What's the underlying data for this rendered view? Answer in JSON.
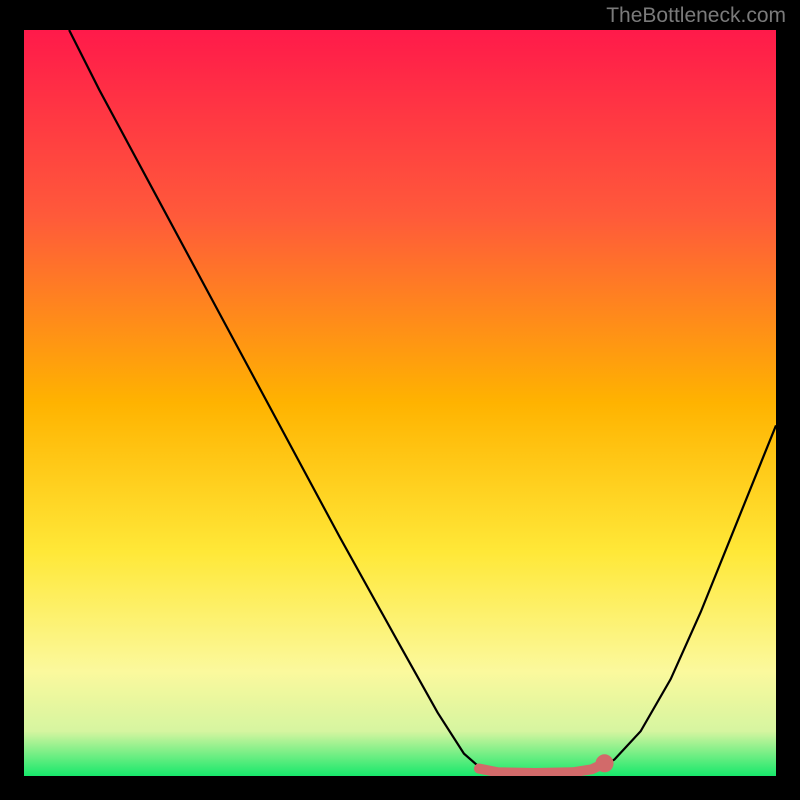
{
  "attribution": "TheBottleneck.com",
  "chart_data": {
    "type": "line",
    "title": "",
    "xlabel": "",
    "ylabel": "",
    "xlim": [
      0,
      100
    ],
    "ylim": [
      0,
      100
    ],
    "background_gradient": {
      "stops": [
        {
          "offset": 0,
          "color": "#ff1a4a"
        },
        {
          "offset": 25,
          "color": "#ff5a3a"
        },
        {
          "offset": 50,
          "color": "#ffb300"
        },
        {
          "offset": 70,
          "color": "#ffe838"
        },
        {
          "offset": 86,
          "color": "#fbf99d"
        },
        {
          "offset": 94,
          "color": "#d6f5a0"
        },
        {
          "offset": 100,
          "color": "#17e86b"
        }
      ]
    },
    "series": [
      {
        "name": "bottleneck-curve",
        "color": "#000000",
        "points": [
          {
            "x": 6.0,
            "y": 100.0
          },
          {
            "x": 10.0,
            "y": 92.0
          },
          {
            "x": 18.0,
            "y": 77.0
          },
          {
            "x": 26.0,
            "y": 62.0
          },
          {
            "x": 34.0,
            "y": 47.0
          },
          {
            "x": 42.0,
            "y": 32.0
          },
          {
            "x": 50.0,
            "y": 17.5
          },
          {
            "x": 55.0,
            "y": 8.5
          },
          {
            "x": 58.5,
            "y": 3.0
          },
          {
            "x": 61.0,
            "y": 0.8
          },
          {
            "x": 66.0,
            "y": 0.4
          },
          {
            "x": 72.0,
            "y": 0.4
          },
          {
            "x": 76.0,
            "y": 0.9
          },
          {
            "x": 78.5,
            "y": 2.2
          },
          {
            "x": 82.0,
            "y": 6.0
          },
          {
            "x": 86.0,
            "y": 13.0
          },
          {
            "x": 90.0,
            "y": 22.0
          },
          {
            "x": 94.0,
            "y": 32.0
          },
          {
            "x": 98.0,
            "y": 42.0
          },
          {
            "x": 100.0,
            "y": 47.0
          }
        ]
      },
      {
        "name": "sweet-spot-marker",
        "color": "#d26a6a",
        "stroke_width": 10,
        "points": [
          {
            "x": 60.5,
            "y": 1.0
          },
          {
            "x": 63.0,
            "y": 0.5
          },
          {
            "x": 68.0,
            "y": 0.4
          },
          {
            "x": 73.0,
            "y": 0.5
          },
          {
            "x": 75.5,
            "y": 0.9
          },
          {
            "x": 77.0,
            "y": 1.6
          }
        ],
        "end_dot": {
          "x": 77.2,
          "y": 1.7,
          "r": 1.2
        }
      }
    ]
  }
}
